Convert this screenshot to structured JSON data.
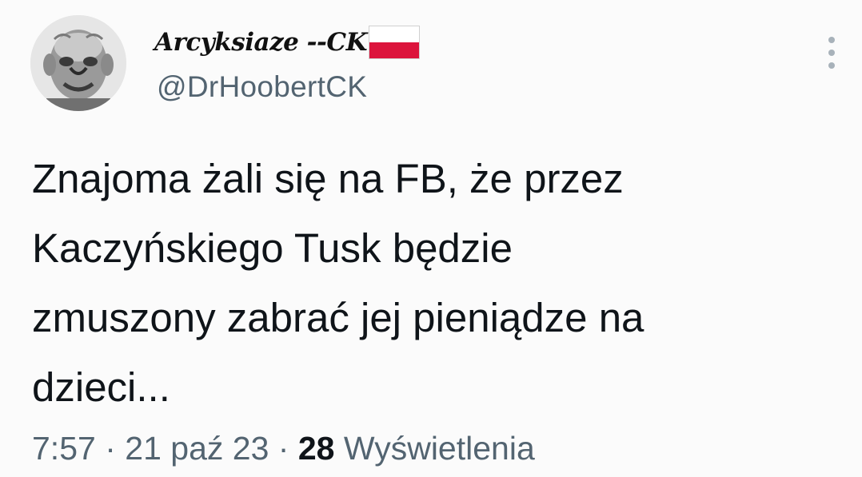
{
  "tweet": {
    "author": {
      "display_name": "Arcyksiaze --CK",
      "handle": "@DrHoobertCK",
      "flag": "poland-flag-icon",
      "avatar": "avatar-elderly-face"
    },
    "text": "Znajoma żali się na FB, że przez\nKaczyńskiego Tusk będzie\nzmuszony zabrać jej pieniądze na\ndzieci...",
    "time": "7:57",
    "separator": "·",
    "date": "21 paź 23",
    "views_count": "28",
    "views_label": "Wyświetlenia",
    "more_icon": "vertical-dots-icon"
  },
  "colors": {
    "background": "#fbfbfb",
    "text": "#0f1419",
    "secondary": "#536471",
    "flag_red": "#dc143c",
    "flag_white": "#ffffff"
  }
}
